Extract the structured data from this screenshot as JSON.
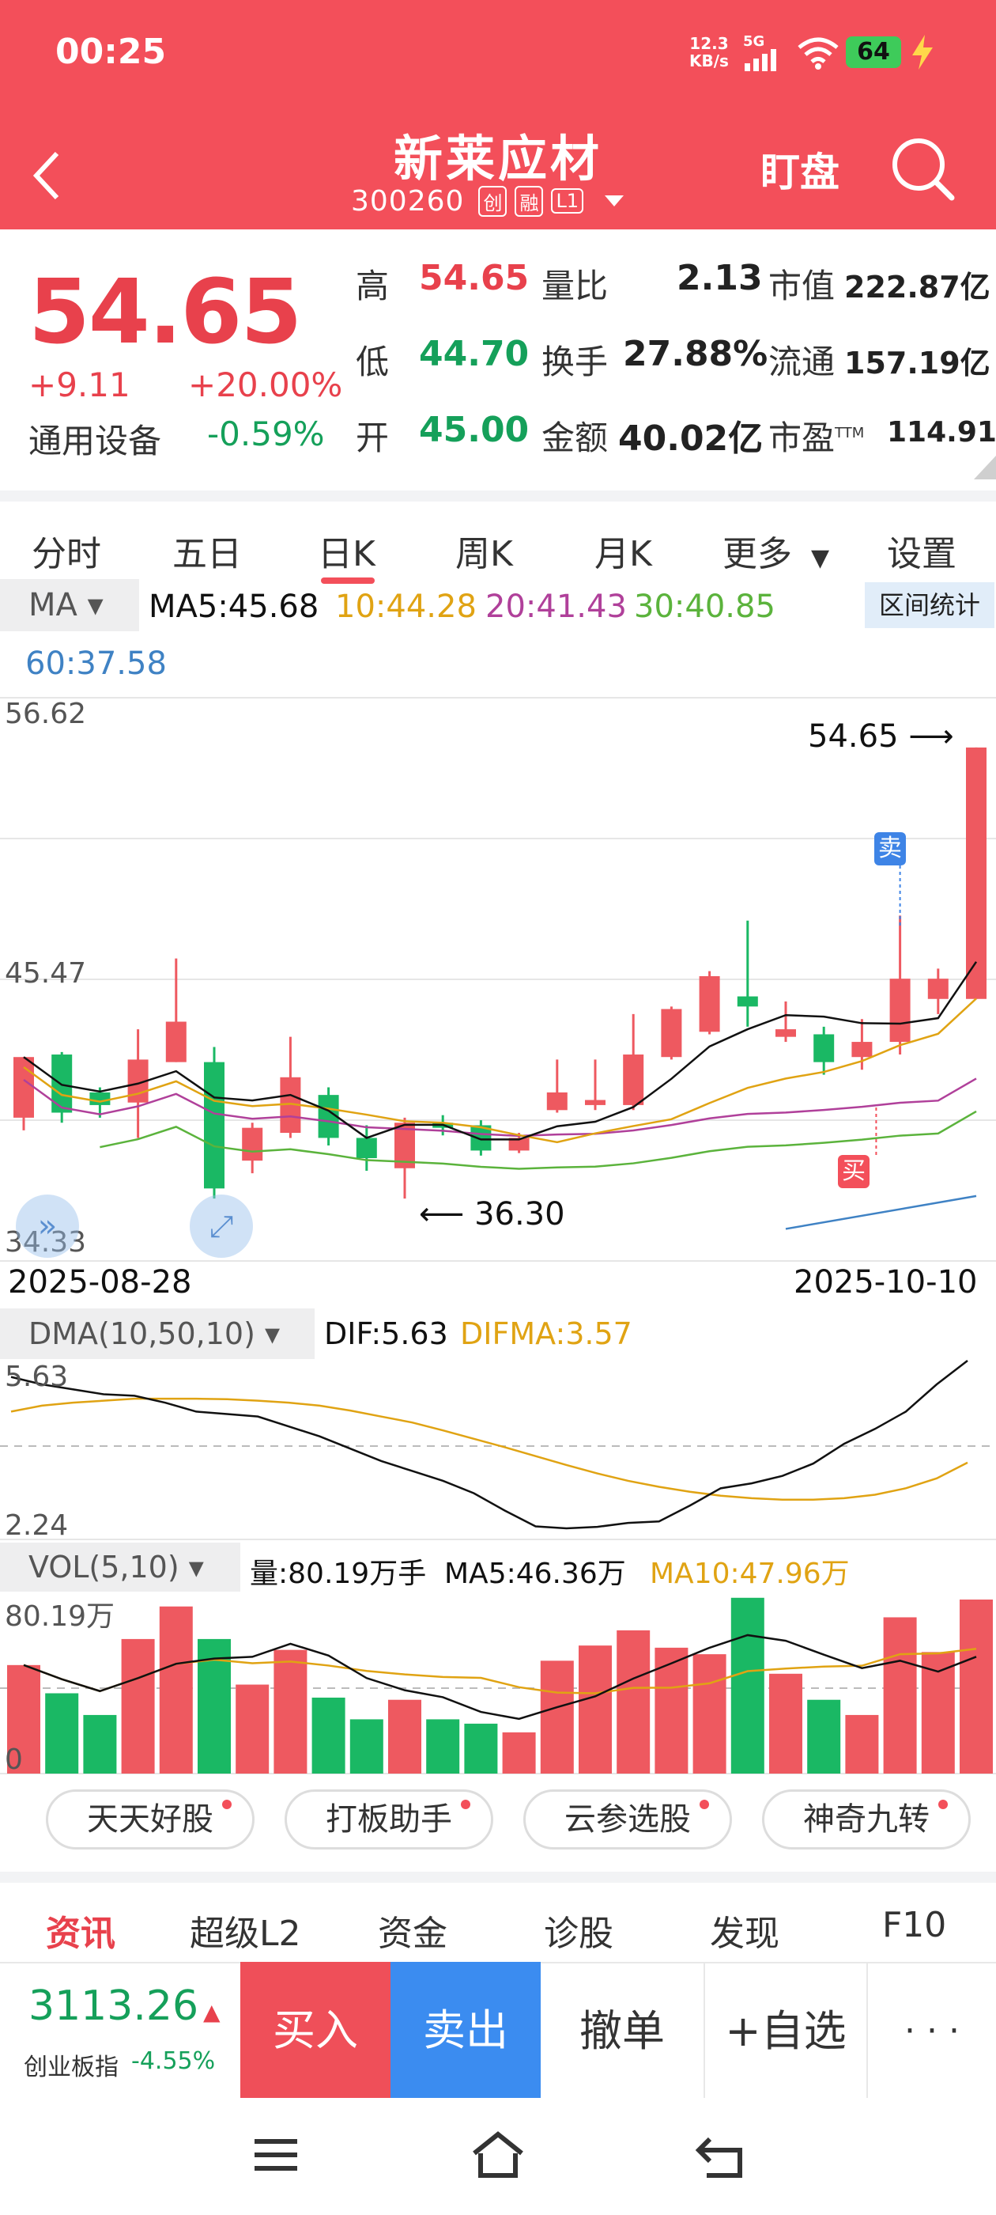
{
  "status_bar": {
    "time": "00:25",
    "net_speed_top": "12.3",
    "net_speed_unit": "KB/s",
    "signal": "5G",
    "battery": "64"
  },
  "header": {
    "title": "新莱应材",
    "code": "300260",
    "badges": [
      "创",
      "融",
      "L1"
    ],
    "watch_label": "盯盘"
  },
  "quote": {
    "price": "54.65",
    "change": "+9.11",
    "change_pct": "+20.00%",
    "sector": "通用设备",
    "sector_pct": "-0.59%",
    "high_label": "高",
    "high": "54.65",
    "low_label": "低",
    "low": "44.70",
    "open_label": "开",
    "open": "45.00",
    "vol_ratio_label": "量比",
    "vol_ratio": "2.13",
    "turnover_label": "换手",
    "turnover": "27.88%",
    "amount_label": "金额",
    "amount": "40.02亿",
    "mktcap_label": "市值",
    "mktcap": "222.87亿",
    "float_label": "流通",
    "float": "157.19亿",
    "pe_label": "市盈",
    "pe_sup": "TTM",
    "pe": "114.91"
  },
  "tabs": [
    "分时",
    "五日",
    "日K",
    "周K",
    "月K",
    "更多",
    "设置"
  ],
  "active_tab": "日K",
  "ma_bar": {
    "selector": "MA",
    "ma5": "MA5:45.68",
    "ma10": "10:44.28",
    "ma20": "20:41.43",
    "ma30": "30:40.85",
    "ma60": "60:37.58",
    "range_btn": "区间统计"
  },
  "kline": {
    "y_top": "56.62",
    "y_mid": "45.47",
    "y_bot": "34.33",
    "max_label": "54.65",
    "min_label": "36.30",
    "date_start": "2025-08-28",
    "date_end": "2025-10-10",
    "sell_tag": "卖",
    "buy_tag": "买"
  },
  "dma_bar": {
    "selector": "DMA(10,50,10)",
    "dif": "DIF:5.63",
    "difma": "DIFMA:3.57",
    "y_top": "5.63",
    "y_bot": "2.24"
  },
  "vol_bar": {
    "selector": "VOL(5,10)",
    "vol": "量:80.19万手",
    "ma5": "MA5:46.36万",
    "ma10": "MA10:47.96万",
    "y_top": "80.19万",
    "y_bot": "0"
  },
  "tools": [
    "天天好股",
    "打板助手",
    "云参选股",
    "神奇九转"
  ],
  "bottom_tabs": [
    "资讯",
    "超级L2",
    "资金",
    "诊股",
    "发现",
    "F10"
  ],
  "index": {
    "value": "3113.26",
    "name": "创业板指",
    "pct": "-4.55%"
  },
  "actions": {
    "buy": "买入",
    "sell": "卖出",
    "cancel": "撤单",
    "add": "+自选",
    "more": "· · ·"
  },
  "colors": {
    "up": "#ee5960",
    "down": "#1ab864",
    "header": "#f34f5a",
    "ma5": "#111111",
    "ma10": "#e0a313",
    "ma20": "#b0409a",
    "ma30": "#5bb33c",
    "ma60": "#3f82c4"
  },
  "chart_data": {
    "type": "candlestick",
    "x_range": [
      "2025-08-28",
      "2025-10-10"
    ],
    "ylim": [
      34.33,
      56.62
    ],
    "candles": [
      {
        "o": 40.0,
        "c": 42.4,
        "h": 42.4,
        "l": 39.5
      },
      {
        "o": 42.5,
        "c": 40.2,
        "h": 42.6,
        "l": 39.8
      },
      {
        "o": 41.0,
        "c": 40.5,
        "h": 41.2,
        "l": 40.0
      },
      {
        "o": 40.6,
        "c": 42.3,
        "h": 43.5,
        "l": 39.2
      },
      {
        "o": 42.2,
        "c": 43.8,
        "h": 46.3,
        "l": 42.2
      },
      {
        "o": 42.2,
        "c": 37.2,
        "h": 42.8,
        "l": 36.8
      },
      {
        "o": 38.3,
        "c": 39.6,
        "h": 39.8,
        "l": 37.8
      },
      {
        "o": 39.4,
        "c": 41.6,
        "h": 43.2,
        "l": 39.2
      },
      {
        "o": 40.9,
        "c": 39.2,
        "h": 41.2,
        "l": 38.9
      },
      {
        "o": 39.2,
        "c": 38.4,
        "h": 39.7,
        "l": 37.9
      },
      {
        "o": 38.0,
        "c": 39.8,
        "h": 40.0,
        "l": 36.8
      },
      {
        "o": 39.8,
        "c": 39.6,
        "h": 40.1,
        "l": 39.3
      },
      {
        "o": 39.7,
        "c": 38.7,
        "h": 39.9,
        "l": 38.5
      },
      {
        "o": 38.7,
        "c": 39.2,
        "h": 39.4,
        "l": 38.6
      },
      {
        "o": 40.3,
        "c": 41.0,
        "h": 42.3,
        "l": 40.2
      },
      {
        "o": 40.5,
        "c": 40.7,
        "h": 42.3,
        "l": 40.3
      },
      {
        "o": 40.5,
        "c": 42.5,
        "h": 44.1,
        "l": 40.3
      },
      {
        "o": 42.4,
        "c": 44.3,
        "h": 44.4,
        "l": 42.3
      },
      {
        "o": 43.4,
        "c": 45.6,
        "h": 45.8,
        "l": 43.3
      },
      {
        "o": 44.8,
        "c": 44.4,
        "h": 47.8,
        "l": 43.6
      },
      {
        "o": 43.2,
        "c": 43.5,
        "h": 44.6,
        "l": 43.0
      },
      {
        "o": 43.3,
        "c": 42.2,
        "h": 43.6,
        "l": 41.7
      },
      {
        "o": 42.4,
        "c": 43.0,
        "h": 43.9,
        "l": 41.9
      },
      {
        "o": 43.0,
        "c": 45.5,
        "h": 48.0,
        "l": 42.5
      },
      {
        "o": 44.7,
        "c": 45.5,
        "h": 45.9,
        "l": 44.1
      },
      {
        "o": 44.7,
        "c": 54.65,
        "h": 54.65,
        "l": 44.7
      }
    ],
    "volume_wan": [
      50,
      37,
      27,
      62,
      77,
      62,
      41,
      57,
      35,
      25,
      34,
      25,
      23,
      19,
      52,
      59,
      66,
      58,
      55,
      81,
      46,
      34,
      27,
      72,
      56,
      80.19
    ],
    "dma": {
      "dif_last": 5.63,
      "difma_last": 3.57,
      "ylim": [
        2.24,
        5.63
      ]
    }
  }
}
